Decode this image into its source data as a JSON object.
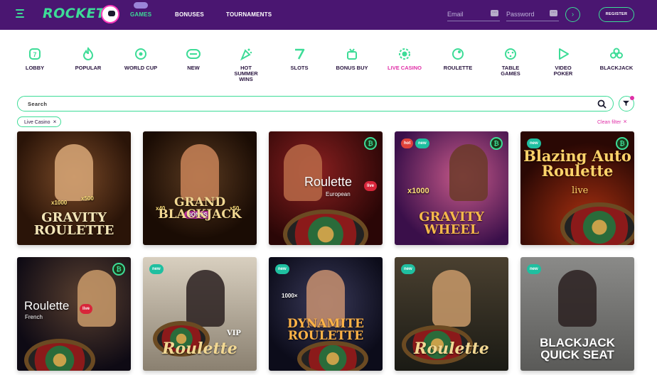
{
  "header": {
    "logo_text": "ROCKET",
    "nav": [
      {
        "label": "GAMES",
        "active": true
      },
      {
        "label": "BONUSES",
        "active": false
      },
      {
        "label": "TOURNAMENTS",
        "active": false
      }
    ],
    "email_placeholder": "Email",
    "password_placeholder": "Password",
    "submit_icon": "›",
    "register_label": "REGISTER",
    "accent_color": "#3ddc97",
    "bg_color": "#4a1671"
  },
  "categories": [
    {
      "label": "LOBBY",
      "icon": "lobby-icon"
    },
    {
      "label": "POPULAR",
      "icon": "flame-icon"
    },
    {
      "label": "WORLD CUP",
      "icon": "ball-icon"
    },
    {
      "label": "NEW",
      "icon": "new-icon"
    },
    {
      "label": "HOT SUMMER WINS",
      "icon": "party-icon"
    },
    {
      "label": "SLOTS",
      "icon": "seven-icon"
    },
    {
      "label": "BONUS BUY",
      "icon": "gift-icon"
    },
    {
      "label": "LIVE CASINO",
      "icon": "chip-icon",
      "active": true
    },
    {
      "label": "ROULETTE",
      "icon": "roulette-icon"
    },
    {
      "label": "TABLE GAMES",
      "icon": "dice-icon"
    },
    {
      "label": "VIDEO POKER",
      "icon": "play-icon"
    },
    {
      "label": "BLACKJACK",
      "icon": "club-icon"
    }
  ],
  "search": {
    "placeholder": "Search"
  },
  "filter_chip": {
    "label": "Live Casino",
    "remove": "×"
  },
  "clean_filter": {
    "label": "Clean filter",
    "icon": "×"
  },
  "games": [
    {
      "title": "GRAVITY ROULETTE",
      "badges": [],
      "coin": false,
      "extras": [
        "x1000",
        "x500"
      ]
    },
    {
      "title": "GRAND BLACKJACK",
      "badges": [],
      "coin": false,
      "extras": [
        "x40",
        "BONUS",
        "x50"
      ]
    },
    {
      "title": "Roulette",
      "subtitle": "European",
      "live": "live",
      "badges": [],
      "coin": true
    },
    {
      "title": "GRAVITY WHEEL",
      "badges": [
        "hot",
        "new"
      ],
      "coin": true,
      "extras": [
        "x1000"
      ]
    },
    {
      "title": "Blazing Auto Roulette",
      "subtitle": "live",
      "badges": [
        "new"
      ],
      "coin": true
    },
    {
      "title": "Roulette",
      "subtitle": "French",
      "live": "live",
      "badges": [],
      "coin": true
    },
    {
      "title": "Roulette",
      "vip": "VIP",
      "badges": [
        "new"
      ],
      "coin": false
    },
    {
      "title": "DYNAMITE ROULETTE",
      "badges": [
        "new"
      ],
      "coin": false,
      "extras": [
        "1000×"
      ]
    },
    {
      "title": "Roulette",
      "badges": [
        "new"
      ],
      "coin": false
    },
    {
      "title": "BLACKJACK QUICK SEAT",
      "badges": [
        "new"
      ],
      "coin": false
    }
  ]
}
